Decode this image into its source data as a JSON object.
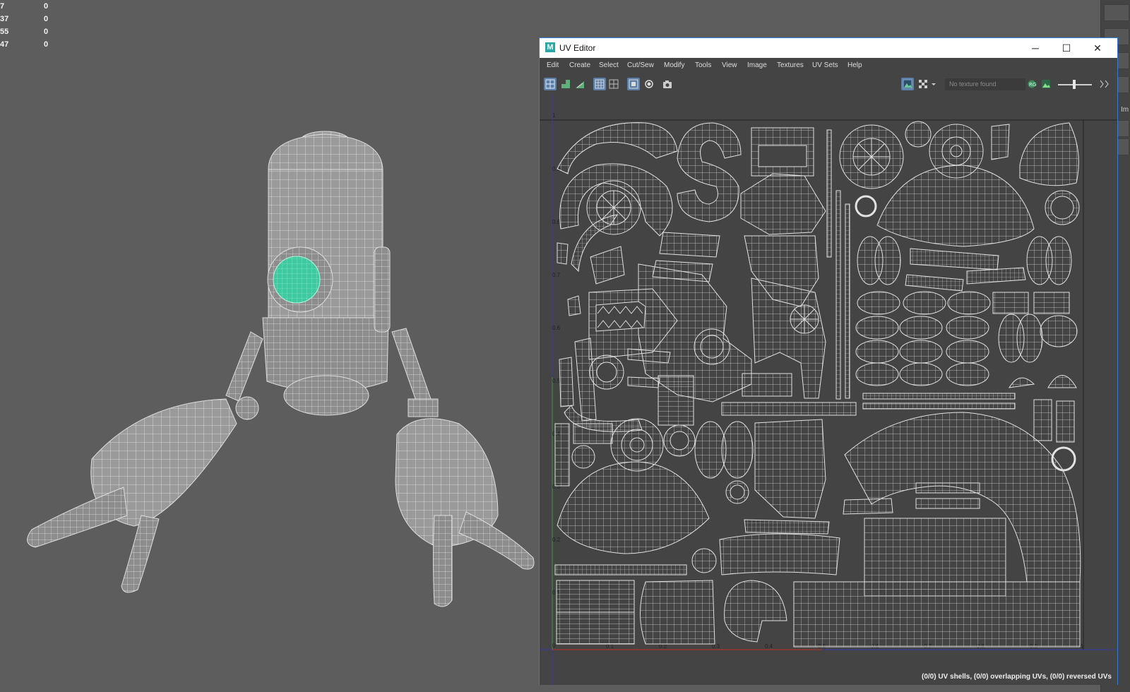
{
  "hud": {
    "rows": [
      {
        "label": "7",
        "value": "0"
      },
      {
        "label": "37",
        "value": "0"
      },
      {
        "label": "55",
        "value": "0"
      },
      {
        "label": "47",
        "value": "0"
      }
    ]
  },
  "window": {
    "title": "UV Editor",
    "app_icon": "M",
    "buttons": {
      "minimize": "─",
      "maximize": "☐",
      "close": "✕"
    }
  },
  "menu": [
    "Edit",
    "Create",
    "Select",
    "Cut/Sew",
    "Modify",
    "Tools",
    "View",
    "Image",
    "Textures",
    "UV Sets",
    "Help"
  ],
  "toolbar": {
    "texture_placeholder": "No texture found",
    "icons": [
      "uv-grid-icon",
      "shell-icon",
      "stack-icon",
      "grid-view-icon",
      "split-view-icon",
      "shaded-icon",
      "circle-icon",
      "camera-icon",
      "image-icon",
      "checker-icon",
      "dropdown-icon",
      "exposure-icon",
      "image-channel-icon",
      "gamma-icon"
    ]
  },
  "uv_grid": {
    "top_tick": "1",
    "v_ticks": [
      "0.9",
      "0.8",
      "0.7",
      "0.6",
      "0.5",
      "0.4",
      "0.3",
      "0.2",
      "0.1",
      "0"
    ],
    "u_ticks": [
      "0.1",
      "0.2",
      "0.3",
      "0.4",
      "0.5",
      "0.6",
      "0.7",
      "0.8",
      "0.9",
      "1"
    ]
  },
  "status": "(0/0) UV shells, (0/0) overlapping UVs, (0/0) reversed UVs",
  "side_panel_label": "Im",
  "colors": {
    "viewport_bg": "#5d5d5d",
    "panel": "#444444",
    "accent": "#2b7fd4",
    "selected_lens": "#3ec9a0"
  }
}
